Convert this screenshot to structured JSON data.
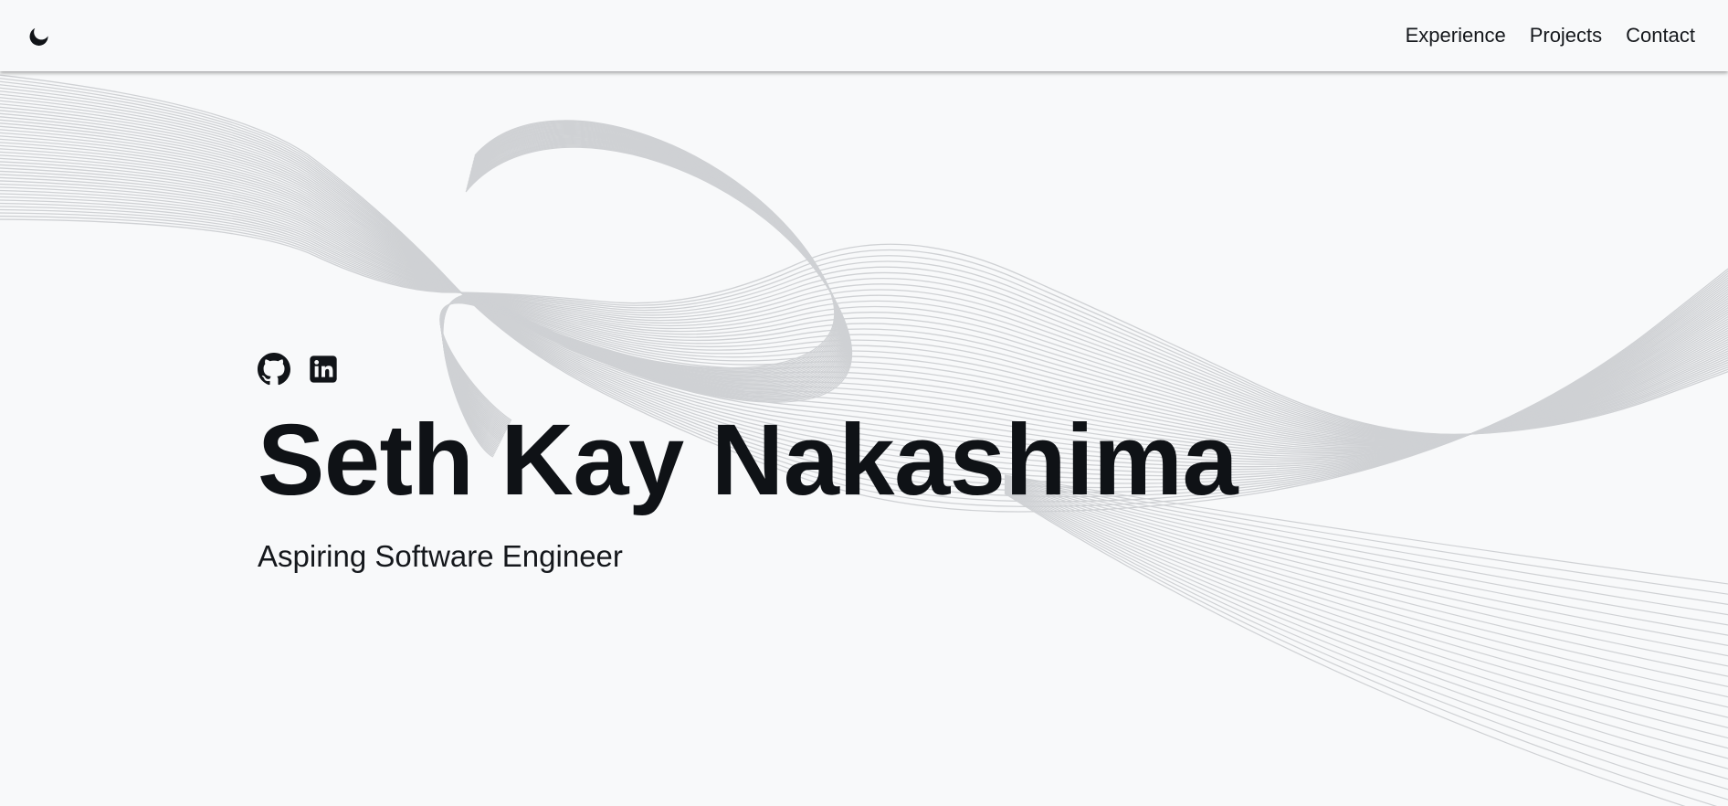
{
  "navbar": {
    "theme_toggle_icon": "moon-icon",
    "links": [
      {
        "label": "Experience"
      },
      {
        "label": "Projects"
      },
      {
        "label": "Contact"
      }
    ]
  },
  "hero": {
    "socials": [
      {
        "icon": "github-icon"
      },
      {
        "icon": "linkedin-icon"
      }
    ],
    "name": "Seth Kay Nakashima",
    "subtitle": "Aspiring Software Engineer"
  },
  "colors": {
    "background": "#f8f9fa",
    "text": "#111418",
    "wave_lines": "#cfd1d4"
  }
}
